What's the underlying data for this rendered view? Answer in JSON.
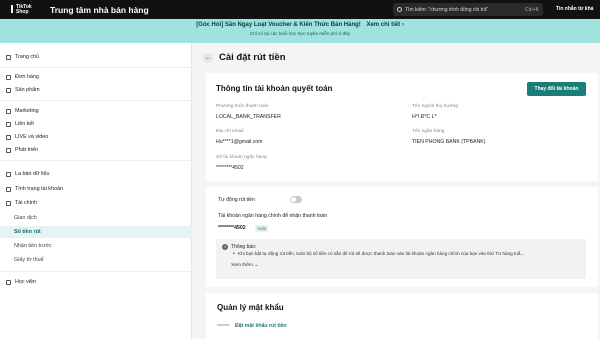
{
  "topbar": {
    "logo_line1": "TikTok",
    "logo_line2": "Shop",
    "app_title": "Trung tâm nhà bán hàng",
    "search_placeholder": "Tìm kiếm: \"chương trình đồng chi trả\"",
    "search_shortcut": "Ctrl+K",
    "message_label": "Tin nhắn từ khá"
  },
  "banner": {
    "headline": "[Góc Hỏi] Săn Ngay Loạt Voucher & Kiến Thức Bán Hàng!",
    "cta": "Xem chi tiết",
    "cta_arrow": "›",
    "subline": "Chỉ có tại các buổi học trực tuyến miễn phí ở đây"
  },
  "sidebar": {
    "items": [
      {
        "label": "Trang chủ",
        "icon": "home-icon"
      },
      {
        "label": "Đơn hàng",
        "icon": "orders-icon"
      },
      {
        "label": "Sản phẩm",
        "icon": "products-icon"
      },
      {
        "label": "Marketing",
        "icon": "marketing-icon"
      },
      {
        "label": "Liên kết",
        "icon": "link-icon"
      },
      {
        "label": "LIVE và video",
        "icon": "video-icon"
      },
      {
        "label": "Phát triển",
        "icon": "growth-icon"
      },
      {
        "label": "La bàn dữ liệu",
        "icon": "compass-icon"
      },
      {
        "label": "Tình trạng tài khoản",
        "icon": "account-health-icon"
      },
      {
        "label": "Tài chính",
        "icon": "finance-icon"
      },
      {
        "label": "Giao dịch"
      },
      {
        "label": "Số tiền rút"
      },
      {
        "label": "Nhận tiền trước"
      },
      {
        "label": "Giấy tờ thuế"
      },
      {
        "label": "Học viện",
        "icon": "academy-icon"
      }
    ]
  },
  "page": {
    "back": "←",
    "title": "Cài đặt rút tiền"
  },
  "settlement": {
    "title": "Thông tin tài khoản quyết toán",
    "change_button": "Thay đổi tài khoản",
    "fields": {
      "payment_method_label": "Phương thức thanh toán",
      "payment_method_value": "LOCAL_BANK_TRANSFER",
      "beneficiary_label": "Tên người thụ hưởng",
      "beneficiary_value": "H*I Đ*C L*",
      "email_label": "Địa chỉ email",
      "email_value": "Hu****1@gmail.com",
      "bank_label": "Tên ngân hàng",
      "bank_value": "TIEN PHONG BANK (TPBANK)",
      "account_no_label": "Số tài khoản ngân hàng",
      "account_no_value": "********4502"
    }
  },
  "auto_withdraw": {
    "label": "Tự động rút tiền",
    "enabled": false,
    "main_account_label": "Tài khoản ngân hàng chính để nhận thanh toán",
    "main_account_value": "********4502",
    "valid_badge": "Valid",
    "notice_title": "Thông báo:",
    "notice_text": "Khi bạn bật tự động rút tiền, toàn bộ số tiền có sẵn để rút sẽ được thanh toán vào tài khoản ngân hàng chính của bạn vào thứ Tư hàng tuầ...",
    "see_more": "Xem thêm ⌄"
  },
  "password": {
    "title": "Quản lý mật khẩu",
    "masked": "******",
    "set_link": "Đặt mật khẩu rút tiền"
  },
  "colors": {
    "accent": "#1b7d78",
    "banner": "#9fe3df",
    "topbar": "#111111",
    "active_nav_bg": "#e7f3f3"
  }
}
